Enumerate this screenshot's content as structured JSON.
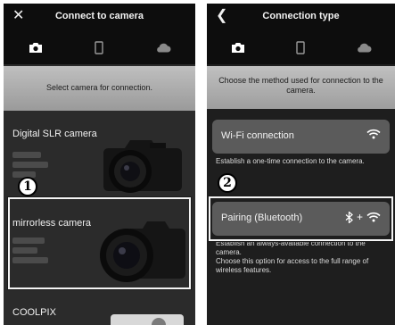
{
  "screen1": {
    "title": "Connect to camera",
    "close_glyph": "✕",
    "tabs": [
      {
        "icon": "camera-icon",
        "active": true
      },
      {
        "icon": "smartphone-icon",
        "active": false
      },
      {
        "icon": "cloud-icon",
        "active": false
      }
    ],
    "prompt": "Select camera for connection.",
    "cameras": [
      {
        "label": "Digital SLR camera"
      },
      {
        "label": "mirrorless camera"
      },
      {
        "label": "COOLPIX"
      }
    ],
    "callout": "1"
  },
  "screen2": {
    "title": "Connection type",
    "back_glyph": "❮",
    "tabs": [
      {
        "icon": "camera-icon",
        "active": true
      },
      {
        "icon": "smartphone-icon",
        "active": false
      },
      {
        "icon": "cloud-icon",
        "active": false
      }
    ],
    "prompt": "Choose the method used for connection to the camera.",
    "options": [
      {
        "label": "Wi-Fi connection",
        "description": "Establish a one-time connection to the camera."
      },
      {
        "label": "Pairing (Bluetooth)",
        "plus": "+",
        "description": "Establish an always-available connection to the camera.\nChoose this option for access to the full range of wireless features."
      }
    ],
    "callout": "2"
  },
  "colors": {
    "topbar": "#0d0d0d",
    "body": "#2b2b2b",
    "option_bg": "#5b5b5b",
    "highlight": "#f4f4f4"
  }
}
